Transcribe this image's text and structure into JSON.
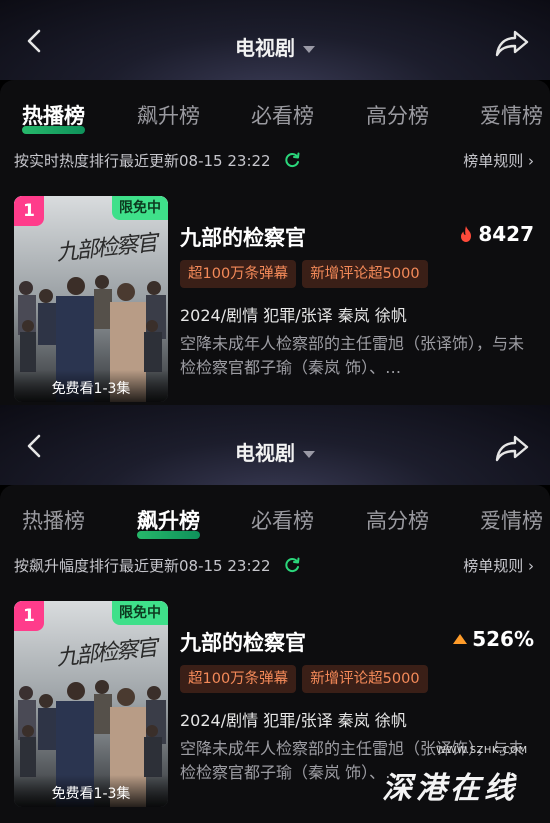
{
  "panels": [
    {
      "header": {
        "title": "电视剧"
      },
      "tabs": [
        "热播榜",
        "飙升榜",
        "必看榜",
        "高分榜",
        "爱情榜"
      ],
      "active_tab": 0,
      "meta_text": "按实时热度排行最近更新08-15 23:22",
      "rules_text": "榜单规则 ›",
      "item": {
        "rank": "1",
        "free_badge": "限免中",
        "free_view": "免费看1-3集",
        "title": "九部的检察官",
        "score": "8427",
        "score_icon": "flame-icon",
        "tags": [
          "超100万条弹幕",
          "新增评论超5000"
        ],
        "info": "2024/剧情 犯罪/张译 秦岚 徐帆",
        "desc": "空降未成年人检察部的主任雷旭（张译饰），与未检检察官都子瑜（秦岚 饰）、…"
      }
    },
    {
      "header": {
        "title": "电视剧"
      },
      "tabs": [
        "热播榜",
        "飙升榜",
        "必看榜",
        "高分榜",
        "爱情榜"
      ],
      "active_tab": 1,
      "meta_text": "按飙升幅度排行最近更新08-15 23:22",
      "rules_text": "榜单规则 ›",
      "item": {
        "rank": "1",
        "free_badge": "限免中",
        "free_view": "免费看1-3集",
        "title": "九部的检察官",
        "score": "526%",
        "score_icon": "trend-up-icon",
        "tags": [
          "超100万条弹幕",
          "新增评论超5000"
        ],
        "info": "2024/剧情 犯罪/张译 秦岚 徐帆",
        "desc": "空降未成年人检察部的主任雷旭（张译饰），与未检检察官都子瑜（秦岚 饰）、…"
      }
    }
  ],
  "watermark": {
    "url": "WWW.SZHK.COM",
    "text": "深港在线"
  },
  "colors": {
    "accent_green": "#2bd67b",
    "rank_pink": "#ff3c8b",
    "tag_text": "#f48a59",
    "flame": "#ff4a3a",
    "trend_up": "#ff9c2a"
  }
}
